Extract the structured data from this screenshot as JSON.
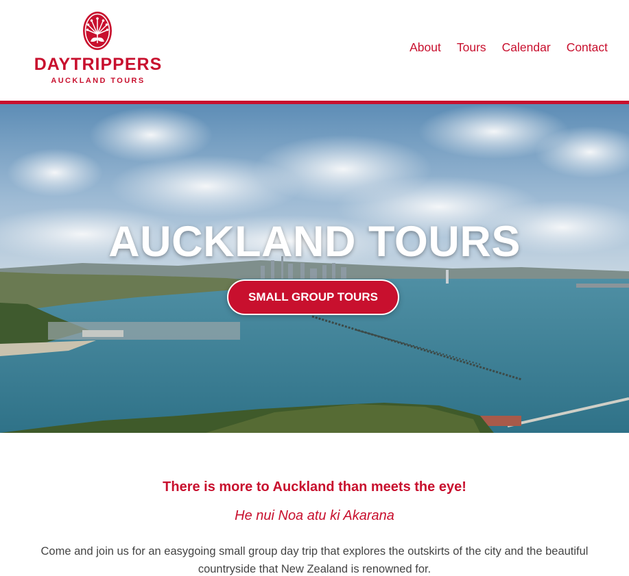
{
  "brand": {
    "name": "DAYTRIPPERS",
    "subtitle": "AUCKLAND TOURS",
    "color": "#c8102e",
    "emblem_icon": "pohutukawa-flower-icon"
  },
  "nav": {
    "items": [
      {
        "label": "About"
      },
      {
        "label": "Tours"
      },
      {
        "label": "Calendar"
      },
      {
        "label": "Contact"
      }
    ]
  },
  "hero": {
    "title": "AUCKLAND TOURS",
    "button_label": "SMALL GROUP TOURS",
    "image": "aerial-view-auckland-harbour"
  },
  "intro": {
    "tagline": "There is more to Auckland than meets the eye!",
    "maori_phrase": "He nui Noa atu ki Akarana",
    "body": "Come and join us for an easygoing small group day trip that explores the outskirts of the city and the beautiful countryside that New Zealand is renowned for."
  }
}
